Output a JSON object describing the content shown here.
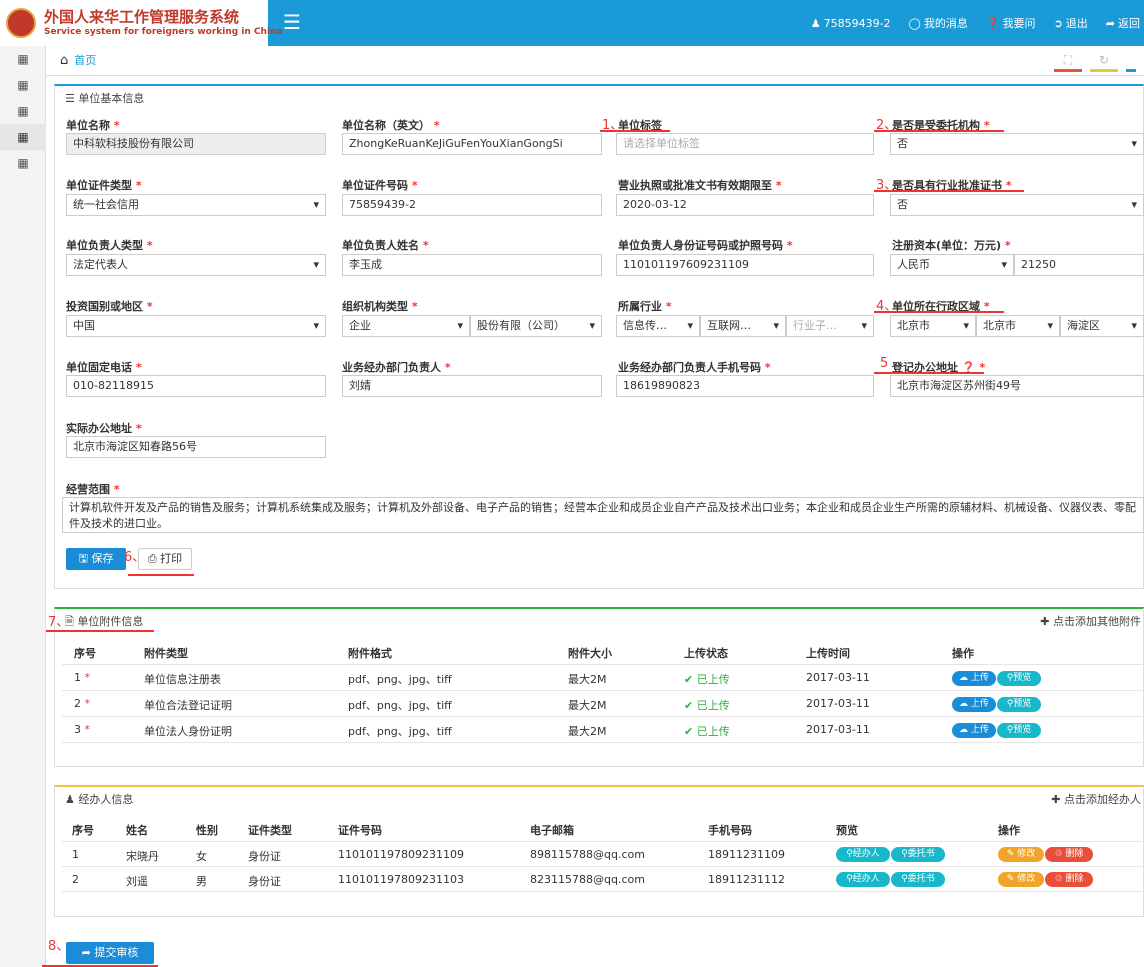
{
  "header": {
    "title_cn": "外国人来华工作管理服务系统",
    "title_en": "Service system for foreigners working in China",
    "menu_icon": "hamburger-icon",
    "user": "75859439-2",
    "messages": "我的消息",
    "help": "我要问",
    "logout": "退出",
    "back": "返回"
  },
  "breadcrumb": {
    "home": "首页"
  },
  "basic": {
    "title": "单位基本信息",
    "markers": {
      "m1": "1、",
      "m2": "2、",
      "m3": "3、",
      "m4": "4、",
      "m5": "5",
      "m6": "6、",
      "m7": "7、",
      "m8": "8、"
    },
    "fields": {
      "name_label": "单位名称",
      "name_value": "中科软科技股份有限公司",
      "name_en_label": "单位名称（英文）",
      "name_en_value": "ZhongKeRuanKeJiGuFenYouXianGongSi",
      "tag_label": "单位标签",
      "tag_placeholder": "请选择单位标签",
      "entrusted_label": "是否是受委托机构",
      "entrusted_value": "否",
      "cert_type_label": "单位证件类型",
      "cert_type_value": "统一社会信用",
      "cert_no_label": "单位证件号码",
      "cert_no_value": "75859439-2",
      "license_label": "营业执照或批准文书有效期限至",
      "license_value": "2020-03-12",
      "industry_cert_label": "是否具有行业批准证书",
      "industry_cert_value": "否",
      "leader_type_label": "单位负责人类型",
      "leader_type_value": "法定代表人",
      "leader_name_label": "单位负责人姓名",
      "leader_name_value": "李玉成",
      "leader_id_label": "单位负责人身份证号码或护照号码",
      "leader_id_value": "110101197609231109",
      "capital_label": "注册资本(单位：万元)",
      "capital_currency": "人民币",
      "capital_value": "21250",
      "country_label": "投资国别或地区",
      "country_value": "中国",
      "org_type_label": "组织机构类型",
      "org_type_value1": "企业",
      "org_type_value2": "股份有限（公司）",
      "industry_label": "所属行业",
      "industry_value1": "信息传…",
      "industry_value2": "互联网…",
      "industry_value3": "行业子…",
      "region_label": "单位所在行政区域",
      "region_value1": "北京市",
      "region_value2": "北京市",
      "region_value3": "海淀区",
      "phone_label": "单位固定电话",
      "phone_value": "010-82118915",
      "dept_head_label": "业务经办部门负责人",
      "dept_head_value": "刘婧",
      "dept_phone_label": "业务经办部门负责人手机号码",
      "dept_phone_value": "18619890823",
      "reg_addr_label": "登记办公地址",
      "reg_addr_value": "北京市海淀区苏州街49号",
      "real_addr_label": "实际办公地址",
      "real_addr_value": "北京市海淀区知春路56号",
      "scope_label": "经营范围",
      "scope_value": "计算机软件开发及产品的销售及服务；计算机系统集成及服务；计算机及外部设备、电子产品的销售；经营本企业和成员企业自产产品及技术出口业务；本企业和成员企业生产所需的原辅材料、机械设备、仪器仪表、零配件及技术的进口业。"
    },
    "save": "保存",
    "print": "打印"
  },
  "attach": {
    "title": "单位附件信息",
    "add": "点击添加其他附件",
    "headers": [
      "序号",
      "附件类型",
      "附件格式",
      "附件大小",
      "上传状态",
      "上传时间",
      "操作"
    ],
    "rows": [
      {
        "no": "1",
        "type": "单位信息注册表",
        "format": "pdf、png、jpg、tiff",
        "size": "最大2M",
        "status": "已上传",
        "time": "2017-03-11"
      },
      {
        "no": "2",
        "type": "单位合法登记证明",
        "format": "pdf、png、jpg、tiff",
        "size": "最大2M",
        "status": "已上传",
        "time": "2017-03-11"
      },
      {
        "no": "3",
        "type": "单位法人身份证明",
        "format": "pdf、png、jpg、tiff",
        "size": "最大2M",
        "status": "已上传",
        "time": "2017-03-11"
      }
    ],
    "upload": "上传",
    "preview": "预览"
  },
  "agent": {
    "title": "经办人信息",
    "add": "点击添加经办人",
    "headers": [
      "序号",
      "姓名",
      "性别",
      "证件类型",
      "证件号码",
      "电子邮箱",
      "手机号码",
      "预览",
      "操作"
    ],
    "rows": [
      {
        "no": "1",
        "name": "宋晓丹",
        "sex": "女",
        "cert": "身份证",
        "id": "110101197809231109",
        "email": "898115788@qq.com",
        "phone": "18911231109"
      },
      {
        "no": "2",
        "name": "刘遥",
        "sex": "男",
        "cert": "身份证",
        "id": "110101197809231103",
        "email": "823115788@qq.com",
        "phone": "18911231112"
      }
    ],
    "preview_agent": "经办人",
    "preview_proxy": "委托书",
    "edit": "修改",
    "delete": "删除"
  },
  "submit": "提交审核",
  "colors": {
    "primary": "#1a9ad6",
    "red": "#e33333",
    "green": "#2bb23a",
    "orange": "#f0a52a"
  }
}
